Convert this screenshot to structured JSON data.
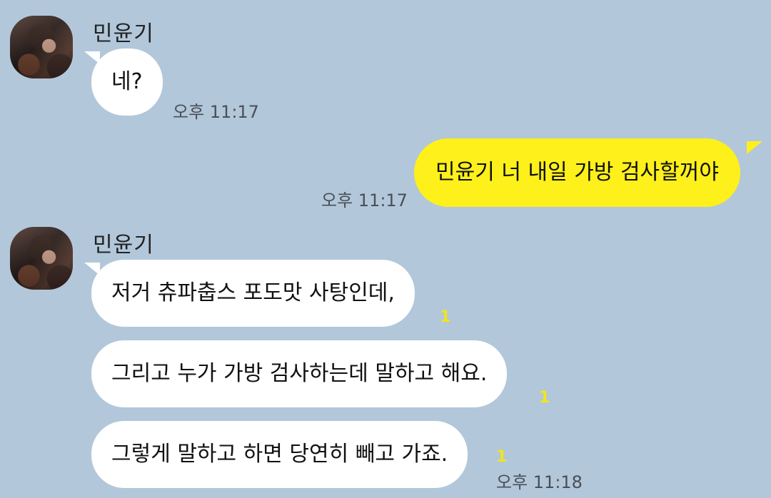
{
  "contact": {
    "name": "민윤기"
  },
  "messages": [
    {
      "sender": "other",
      "text": "네?",
      "time": "오후 11:17"
    },
    {
      "sender": "me",
      "text": "민윤기 너 내일 가방 검사할꺼야",
      "time": "오후 11:17"
    },
    {
      "sender": "other",
      "text": "저거 츄파춥스 포도맛 사탕인데,",
      "unread": "1"
    },
    {
      "sender": "other",
      "text": "그리고 누가 가방 검사하는데 말하고 해요.",
      "unread": "1"
    },
    {
      "sender": "other",
      "text": "그렇게 말하고 하면 당연히 빼고 가죠.",
      "unread": "1",
      "time": "오후 11:18"
    }
  ],
  "colors": {
    "background": "#b2c7da",
    "my_bubble": "#fef01b",
    "other_bubble": "#ffffff",
    "unread": "#f2e51b"
  },
  "icons": {
    "avatar": "profile-photo"
  }
}
